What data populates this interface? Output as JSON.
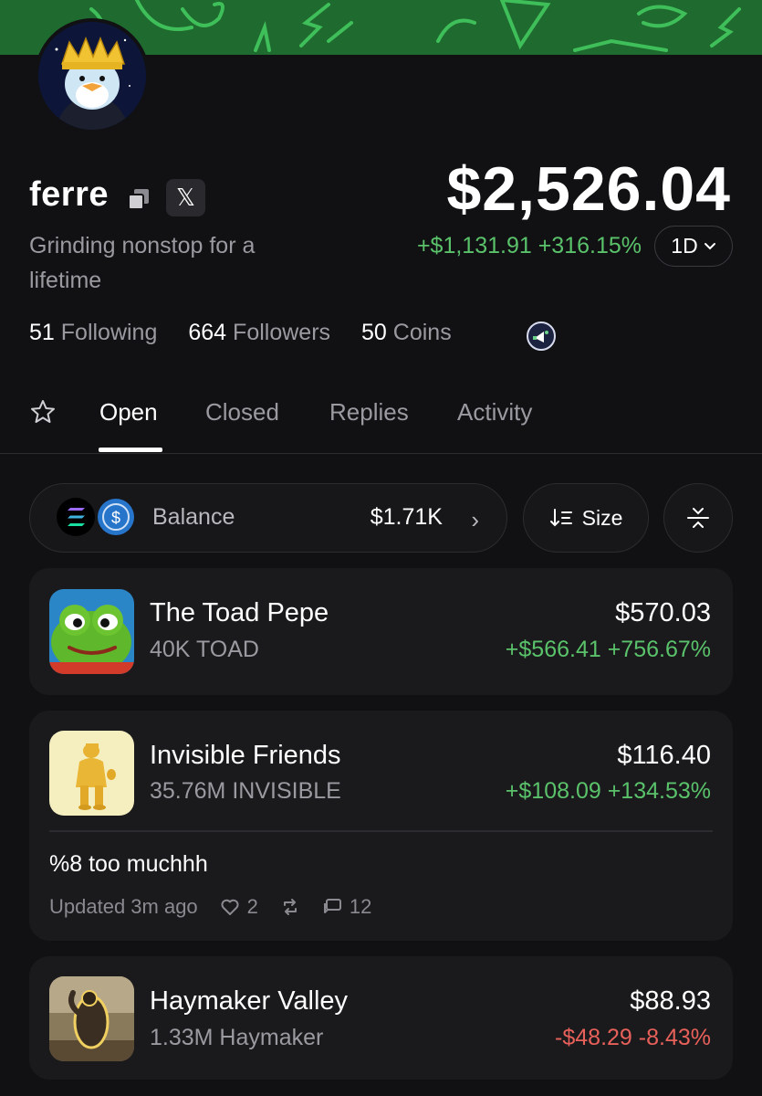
{
  "profile": {
    "username": "ferre",
    "x_label": "𝕏",
    "bio": "Grinding nonstop for a lifetime",
    "total_value": "$2,526.04",
    "change": "+$1,131.91 +316.15%",
    "range": "1D",
    "stats": [
      {
        "count": "51",
        "label": "Following"
      },
      {
        "count": "664",
        "label": "Followers"
      },
      {
        "count": "50",
        "label": "Coins"
      }
    ]
  },
  "tabs": [
    {
      "label": "Open"
    },
    {
      "label": "Closed"
    },
    {
      "label": "Replies"
    },
    {
      "label": "Activity"
    }
  ],
  "balance": {
    "label": "Balance",
    "value": "$1.71K",
    "chevron": "›"
  },
  "sort": {
    "label": "Size"
  },
  "positions": [
    {
      "name": "The Toad Pepe",
      "amount": "40K TOAD",
      "value": "$570.03",
      "change": "+$566.41 +756.67%",
      "trend": "up"
    },
    {
      "name": "Invisible Friends",
      "amount": "35.76M INVISIBLE",
      "value": "$116.40",
      "change": "+$108.09 +134.53%",
      "trend": "up",
      "note": "%8 too muchhh",
      "updated": "Updated 3m ago",
      "likes": "2",
      "comments": "12"
    },
    {
      "name": "Haymaker Valley",
      "amount": "1.33M Haymaker",
      "value": "$88.93",
      "change": "-$48.29 -8.43%",
      "trend": "down"
    }
  ],
  "colors": {
    "background": "#111114",
    "card": "#1a1a1d",
    "positive": "#5ac26a",
    "negative": "#e8605a",
    "banner": "#1f6b2f"
  }
}
